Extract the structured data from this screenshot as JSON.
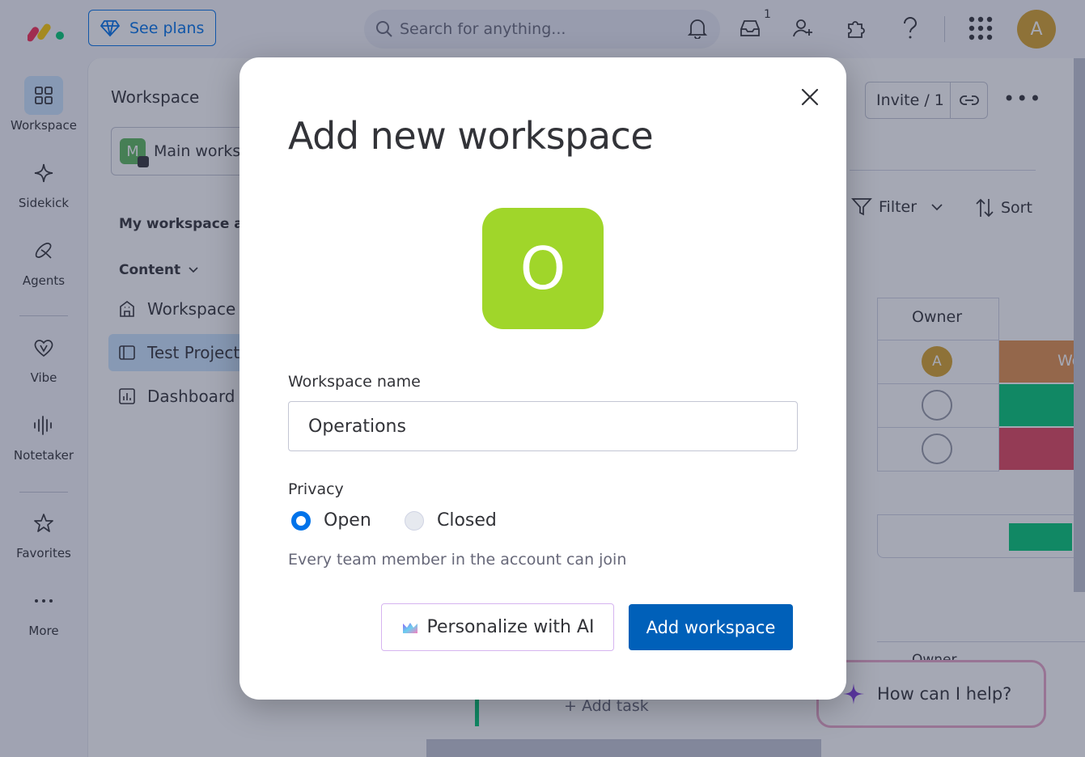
{
  "topbar": {
    "see_plans": "See plans",
    "search_placeholder": "Search for anything...",
    "inbox_count": "1",
    "avatar_initial": "A"
  },
  "rail": {
    "items": [
      {
        "label": "Workspace",
        "icon": "grid-icon"
      },
      {
        "label": "Sidekick",
        "icon": "sparkle-icon"
      },
      {
        "label": "Agents",
        "icon": "agents-icon"
      },
      {
        "label": "Vibe",
        "icon": "heart-icon"
      },
      {
        "label": "Notetaker",
        "icon": "waveform-icon"
      },
      {
        "label": "Favorites",
        "icon": "star-icon"
      },
      {
        "label": "More",
        "icon": "more-dots-icon"
      }
    ]
  },
  "panel": {
    "title": "Workspace",
    "workspace_initial": "M",
    "workspace_name": "Main works",
    "section_title": "My workspace age",
    "content_label": "Content",
    "nav": [
      {
        "label": "Workspace h",
        "icon": "building-icon"
      },
      {
        "label": "Test Project",
        "icon": "board-icon"
      },
      {
        "label": "Dashboard a",
        "icon": "dashboard-icon"
      }
    ]
  },
  "board": {
    "invite_label": "Invite / 1",
    "filter_label": "Filter",
    "sort_label": "Sort",
    "owner_header": "Owner",
    "owner_avatar_initial": "A",
    "status_text": "Wo",
    "add_task": "+ Add task",
    "owner_header_lower": "Owner",
    "help_text": "How can I help?"
  },
  "modal": {
    "title": "Add new workspace",
    "icon_letter": "O",
    "icon_color": "#a0d62a",
    "name_label": "Workspace name",
    "name_value": "Operations",
    "privacy_label": "Privacy",
    "privacy_options": [
      {
        "label": "Open",
        "selected": true
      },
      {
        "label": "Closed",
        "selected": false
      }
    ],
    "privacy_description": "Every team member in the account can join",
    "personalize_label": "Personalize with AI",
    "add_label": "Add workspace"
  },
  "colors": {
    "primary": "#0073ea",
    "primary_button": "#0060b9",
    "status_orange": "#e2904a",
    "status_green": "#00c875",
    "status_red": "#e2445c"
  }
}
